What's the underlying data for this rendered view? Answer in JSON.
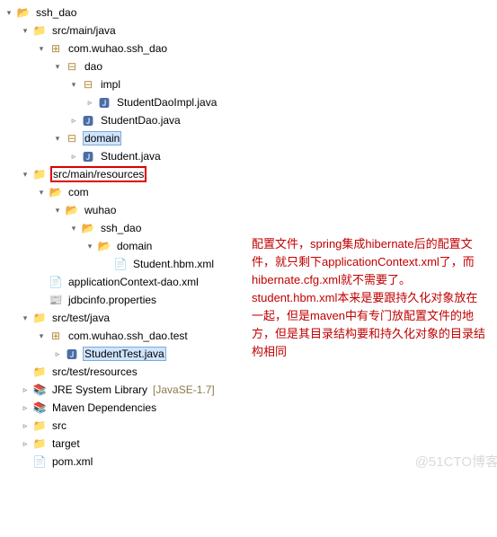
{
  "tree": {
    "root": "ssh_dao",
    "src_main_java": "src/main/java",
    "pkg_root": "com.wuhao.ssh_dao",
    "pkg_dao": "dao",
    "pkg_impl": "impl",
    "file_daoimpl": "StudentDaoImpl.java",
    "file_dao": "StudentDao.java",
    "pkg_domain": "domain",
    "file_student": "Student.java",
    "src_main_res": "src/main/resources",
    "fld_com": "com",
    "fld_wuhao": "wuhao",
    "fld_sshdao": "ssh_dao",
    "fld_domain": "domain",
    "file_hbm": "Student.hbm.xml",
    "file_appctx": "applicationContext-dao.xml",
    "file_jdbc": "jdbcinfo.properties",
    "src_test_java": "src/test/java",
    "pkg_test": "com.wuhao.ssh_dao.test",
    "file_test": "StudentTest.java",
    "src_test_res": "src/test/resources",
    "jre": "JRE System Library",
    "jre_deco": "[JavaSE-1.7]",
    "maven": "Maven Dependencies",
    "fld_src": "src",
    "fld_target": "target",
    "file_pom": "pom.xml"
  },
  "annotation": "配置文件，spring集成hibernate后的配置文件，就只剩下applicationContext.xml了，而hibernate.cfg.xml就不需要了。student.hbm.xml本来是要跟持久化对象放在一起，但是maven中有专门放配置文件的地方，但是其目录结构要和持久化对象的目录结构相同",
  "watermark": "@51CTO博客"
}
